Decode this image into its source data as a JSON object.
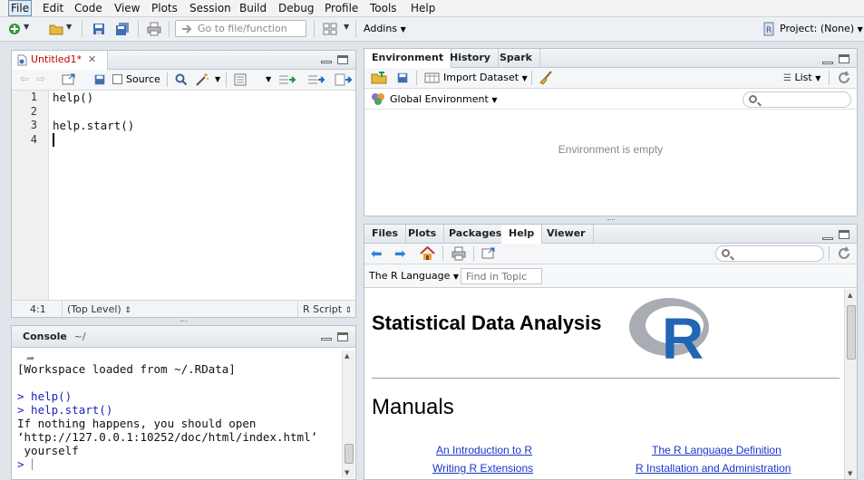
{
  "menu": [
    "File",
    "Edit",
    "Code",
    "View",
    "Plots",
    "Session",
    "Build",
    "Debug",
    "Profile",
    "Tools",
    "Help"
  ],
  "toolbar": {
    "goto_placeholder": "Go to file/function",
    "addins_label": "Addins",
    "project_label": "Project: (None)"
  },
  "editor": {
    "tab_label": "Untitled1*",
    "source_label": "Source",
    "lines": [
      {
        "num": "1",
        "code": "help()"
      },
      {
        "num": "2",
        "code": ""
      },
      {
        "num": "3",
        "code": "help.start()"
      },
      {
        "num": "4",
        "code": ""
      }
    ],
    "status_position": "4:1",
    "status_scope": "(Top Level)",
    "status_filetype": "R Script"
  },
  "console": {
    "tab_label": "Console",
    "path": "~/",
    "lines": [
      {
        "text": "[Workspace loaded from ~/.RData]",
        "cls": "out"
      },
      {
        "text": "",
        "cls": "out"
      },
      {
        "text": "> help()",
        "cls": "cmd"
      },
      {
        "text": "> help.start()",
        "cls": "cmd"
      },
      {
        "text": "If nothing happens, you should open",
        "cls": "out"
      },
      {
        "text": "‘http://127.0.0.1:10252/doc/html/index.html’",
        "cls": "out"
      },
      {
        "text": " yourself",
        "cls": "out"
      }
    ],
    "prompt": ">"
  },
  "env_panel": {
    "tabs": [
      "Environment",
      "History",
      "Spark"
    ],
    "import_label": "Import Dataset",
    "list_label": "List",
    "scope_label": "Global Environment",
    "empty_text": "Environment is empty"
  },
  "help_panel": {
    "tabs": [
      "Files",
      "Plots",
      "Packages",
      "Help",
      "Viewer"
    ],
    "topic_label": "The R Language",
    "find_placeholder": "Find in Topic",
    "heading": "Statistical Data Analysis",
    "logo_letter": "R",
    "manuals_heading": "Manuals",
    "links": [
      "An Introduction to R",
      "The R Language Definition",
      "Writing R Extensions",
      "R Installation and Administration"
    ]
  },
  "colors": {
    "accent_blue": "#2268c8",
    "tab_modified": "#c00000",
    "link": "#1a36c7",
    "console_cmd": "#1a23b8"
  }
}
